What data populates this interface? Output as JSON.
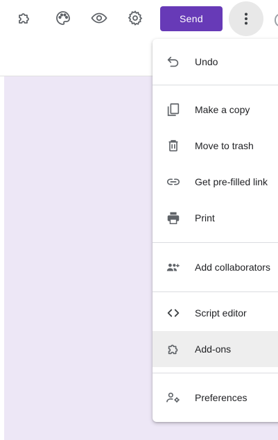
{
  "toolbar": {
    "send_label": "Send",
    "icons": [
      "addons-icon",
      "palette-icon",
      "eye-icon",
      "gear-icon",
      "more-vert-icon"
    ]
  },
  "menu": {
    "items": [
      {
        "label": "Undo",
        "icon": "undo-icon"
      },
      {
        "label": "Make a copy",
        "icon": "copy-icon"
      },
      {
        "label": "Move to trash",
        "icon": "trash-icon"
      },
      {
        "label": "Get pre-filled link",
        "icon": "link-icon"
      },
      {
        "label": "Print",
        "icon": "print-icon"
      },
      {
        "label": "Add collaborators",
        "icon": "collaborators-icon"
      },
      {
        "label": "Script editor",
        "icon": "code-icon"
      },
      {
        "label": "Add-ons",
        "icon": "addons-icon"
      },
      {
        "label": "Preferences",
        "icon": "preferences-icon"
      }
    ]
  },
  "colors": {
    "accent": "#673ab7",
    "canvas": "#ede7f6",
    "hover": "#eeeeee"
  }
}
